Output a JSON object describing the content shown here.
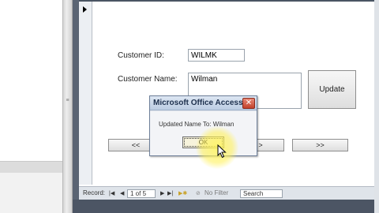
{
  "form": {
    "customer_id_label": "Customer ID:",
    "customer_id_value": "WILMK",
    "customer_name_label": "Customer Name:",
    "customer_name_value": "Wilman",
    "update_button": "Update",
    "first_button": "<<",
    "next_button": ">",
    "last_button": ">>"
  },
  "dialog": {
    "title": "Microsoft Office Access",
    "message": "Updated Name To: Wilman",
    "ok_button": "OK",
    "close_glyph": "✕"
  },
  "navbar": {
    "record_label": "Record:",
    "position": "1 of 5",
    "filter_label": "No Filter",
    "search_placeholder": "Search"
  },
  "colors": {
    "frame": "#4c5564",
    "dialog_close": "#c2402a",
    "highlight": "#fff05a"
  }
}
